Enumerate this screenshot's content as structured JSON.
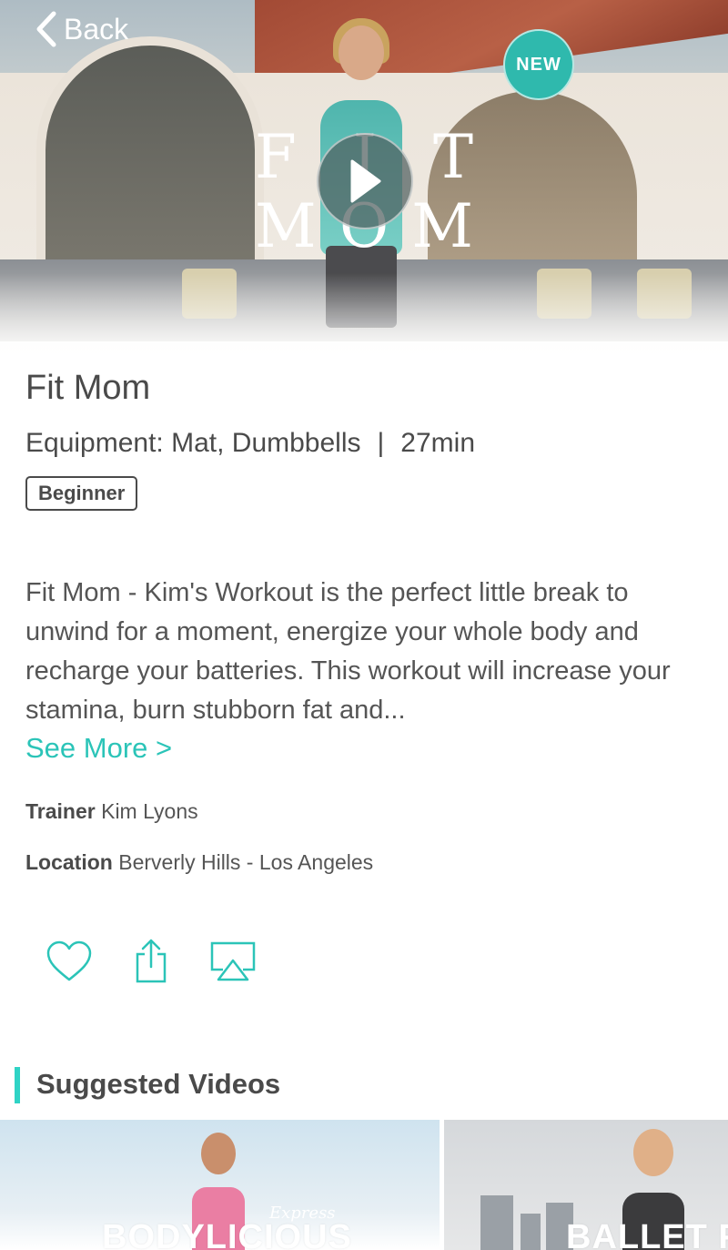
{
  "nav": {
    "back_label": "Back"
  },
  "hero": {
    "badge": "NEW",
    "logo_row1": [
      "F",
      "I",
      "T"
    ],
    "logo_row2": [
      "M",
      "O",
      "M"
    ]
  },
  "workout": {
    "title": "Fit Mom",
    "equipment": "Equipment: Mat, Dumbbells",
    "separator": "|",
    "duration": "27min",
    "level": "Beginner",
    "description": "Fit Mom - Kim's Workout is the perfect little break to unwind for a moment, energize your whole body and recharge your batteries. This workout will increase your stamina, burn stubborn fat and...",
    "see_more": "See More >",
    "trainer_label": "Trainer",
    "trainer": "Kim Lyons",
    "location_label": "Location",
    "location": "Berverly Hills - Los Angeles"
  },
  "actions": {
    "icons": [
      "heart-icon",
      "share-icon",
      "airplay-icon"
    ]
  },
  "suggested": {
    "title": "Suggested Videos",
    "items": [
      {
        "label": "BODYLICIOUS",
        "script": "Express"
      },
      {
        "label": "BALLET F"
      }
    ]
  },
  "colors": {
    "accent": "#2bc4b8",
    "badge": "#2fb9ad",
    "text": "#4a4a4a"
  }
}
